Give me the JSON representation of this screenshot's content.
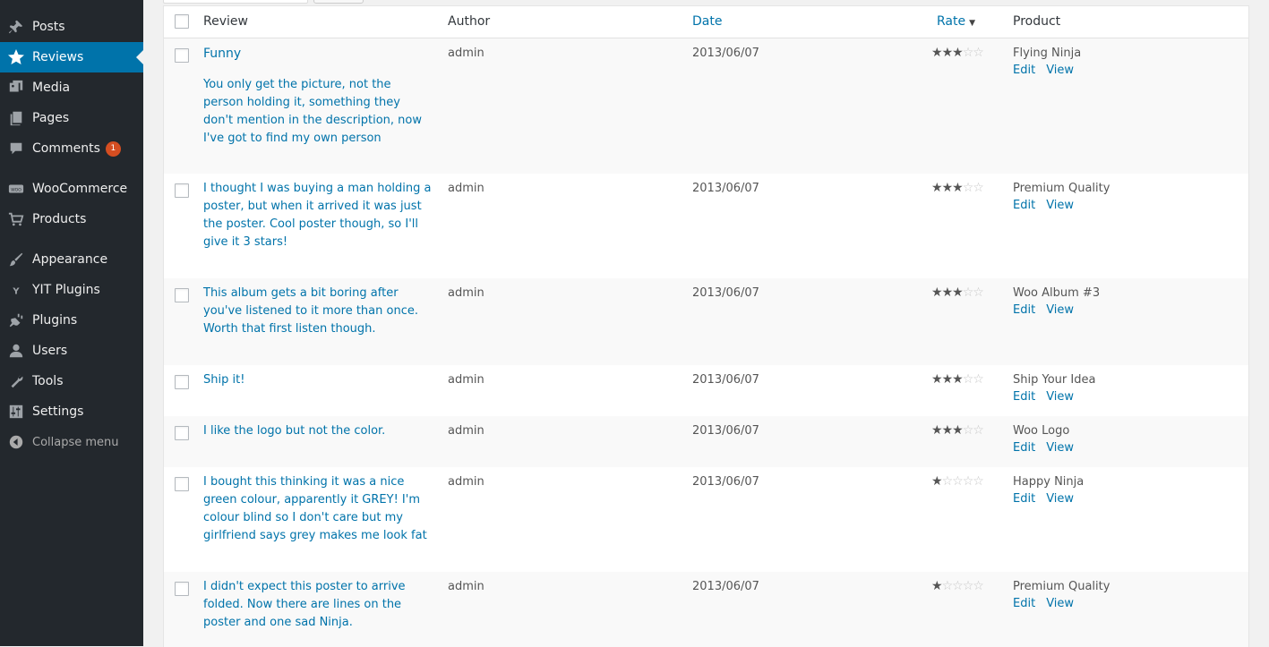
{
  "sidebar": {
    "items": [
      {
        "label": "Posts",
        "icon": "pin-icon"
      },
      {
        "label": "Reviews",
        "icon": "star-icon",
        "active": true
      },
      {
        "label": "Media",
        "icon": "media-icon"
      },
      {
        "label": "Pages",
        "icon": "pages-icon"
      },
      {
        "label": "Comments",
        "icon": "comment-icon",
        "badge": "1"
      },
      {
        "label": "WooCommerce",
        "icon": "woo-icon"
      },
      {
        "label": "Products",
        "icon": "cart-icon"
      },
      {
        "label": "Appearance",
        "icon": "brush-icon"
      },
      {
        "label": "YIT Plugins",
        "icon": "yit-icon"
      },
      {
        "label": "Plugins",
        "icon": "plug-icon"
      },
      {
        "label": "Users",
        "icon": "user-icon"
      },
      {
        "label": "Tools",
        "icon": "wrench-icon"
      },
      {
        "label": "Settings",
        "icon": "sliders-icon"
      }
    ],
    "collapse_label": "Collapse menu"
  },
  "table": {
    "columns": {
      "review": "Review",
      "author": "Author",
      "date": "Date",
      "rate": "Rate",
      "product": "Product"
    },
    "sort_indicator": "▼",
    "actions": {
      "edit": "Edit",
      "view": "View"
    },
    "rows": [
      {
        "title": "Funny",
        "text": "You only get the picture, not the person holding it, something they don't mention in the description, now I've got to find my own person",
        "author": "admin",
        "date": "2013/06/07",
        "rating": 3,
        "product": "Flying Ninja"
      },
      {
        "title": "",
        "text": "I thought I was buying a man holding a poster, but when it arrived it was just the poster. Cool poster though, so I'll give it 3 stars!",
        "author": "admin",
        "date": "2013/06/07",
        "rating": 3,
        "product": "Premium Quality"
      },
      {
        "title": "",
        "text": "This album gets a bit boring after you've listened to it more than once. Worth that first listen though.",
        "author": "admin",
        "date": "2013/06/07",
        "rating": 3,
        "product": "Woo Album #3"
      },
      {
        "title": "",
        "text": "Ship it!",
        "author": "admin",
        "date": "2013/06/07",
        "rating": 3,
        "product": "Ship Your Idea"
      },
      {
        "title": "",
        "text": "I like the logo but not the color.",
        "author": "admin",
        "date": "2013/06/07",
        "rating": 3,
        "product": "Woo Logo"
      },
      {
        "title": "",
        "text": "I bought this thinking it was a nice green colour, apparently it GREY! I'm colour blind so I don't care but my girlfriend says grey makes me look fat",
        "author": "admin",
        "date": "2013/06/07",
        "rating": 1,
        "product": "Happy Ninja"
      },
      {
        "title": "",
        "text": "I didn't expect this poster to arrive folded. Now there are lines on the poster and one sad Ninja.",
        "author": "admin",
        "date": "2013/06/07",
        "rating": 1,
        "product": "Premium Quality"
      }
    ]
  }
}
